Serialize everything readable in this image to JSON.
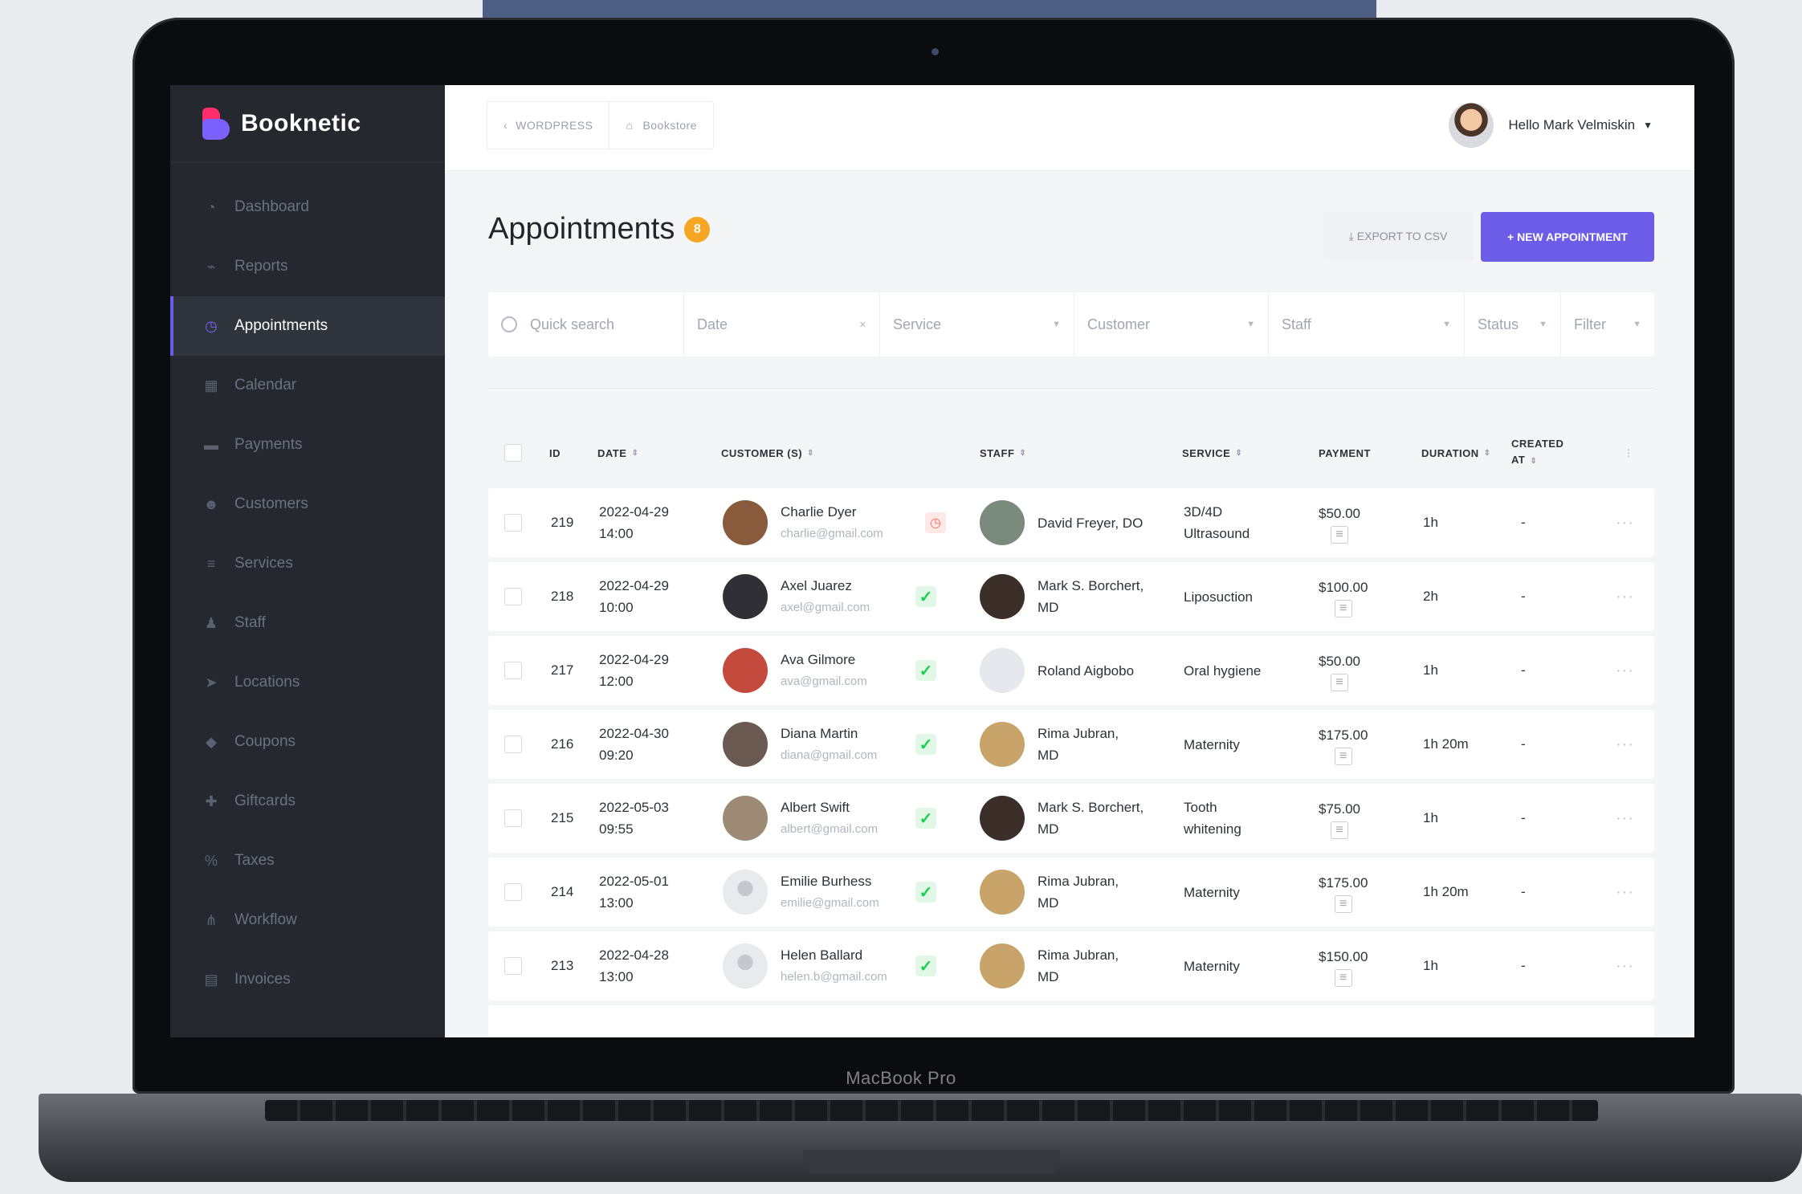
{
  "device": {
    "label": "MacBook Pro"
  },
  "brand": {
    "name": "Booknetic"
  },
  "sidebar": {
    "items": [
      {
        "label": "Dashboard",
        "icon": "dashboard-icon"
      },
      {
        "label": "Reports",
        "icon": "chart-icon"
      },
      {
        "label": "Appointments",
        "icon": "clock-icon",
        "active": true
      },
      {
        "label": "Calendar",
        "icon": "calendar-icon"
      },
      {
        "label": "Payments",
        "icon": "card-icon"
      },
      {
        "label": "Customers",
        "icon": "users-icon"
      },
      {
        "label": "Services",
        "icon": "list-icon"
      },
      {
        "label": "Staff",
        "icon": "person-icon"
      },
      {
        "label": "Locations",
        "icon": "location-icon"
      },
      {
        "label": "Coupons",
        "icon": "tag-icon"
      },
      {
        "label": "Giftcards",
        "icon": "gift-icon"
      },
      {
        "label": "Taxes",
        "icon": "percent-icon"
      },
      {
        "label": "Workflow",
        "icon": "workflow-icon"
      },
      {
        "label": "Invoices",
        "icon": "file-icon"
      }
    ]
  },
  "header": {
    "breadcrumb_back": "WORDPRESS",
    "breadcrumb_current": "Bookstore",
    "user_greeting": "Hello Mark Velmiskin"
  },
  "page": {
    "title": "Appointments",
    "count": "8",
    "export_label": "EXPORT TO CSV",
    "new_label": "+ NEW APPOINTMENT"
  },
  "filters": {
    "search_placeholder": "Quick search",
    "date": "Date",
    "service": "Service",
    "customer": "Customer",
    "staff": "Staff",
    "status": "Status",
    "filter": "Filter"
  },
  "table": {
    "columns": {
      "id": "ID",
      "date": "DATE",
      "customers": "CUSTOMER (S)",
      "staff": "STAFF",
      "service": "SERVICE",
      "payment": "PAYMENT",
      "duration": "DURATION",
      "created_line1": "CREATED",
      "created_line2": "AT"
    },
    "rows": [
      {
        "id": "219",
        "date": "2022-04-29",
        "time": "14:00",
        "customer": "Charlie Dyer",
        "email": "charlie@gmail.com",
        "status": "pending",
        "staff_l1": "David Freyer, DO",
        "staff_l2": "",
        "service_l1": "3D/4D",
        "service_l2": "Ultrasound",
        "payment": "$50.00",
        "duration": "1h",
        "created": "-"
      },
      {
        "id": "218",
        "date": "2022-04-29",
        "time": "10:00",
        "customer": "Axel Juarez",
        "email": "axel@gmail.com",
        "status": "approved",
        "staff_l1": "Mark S. Borchert,",
        "staff_l2": "MD",
        "service_l1": "Liposuction",
        "service_l2": "",
        "payment": "$100.00",
        "duration": "2h",
        "created": "-"
      },
      {
        "id": "217",
        "date": "2022-04-29",
        "time": "12:00",
        "customer": "Ava Gilmore",
        "email": "ava@gmail.com",
        "status": "approved",
        "staff_l1": "Roland Aigbobo",
        "staff_l2": "",
        "service_l1": "Oral hygiene",
        "service_l2": "",
        "payment": "$50.00",
        "duration": "1h",
        "created": "-"
      },
      {
        "id": "216",
        "date": "2022-04-30",
        "time": "09:20",
        "customer": "Diana Martin",
        "email": "diana@gmail.com",
        "status": "approved",
        "staff_l1": "Rima Jubran,",
        "staff_l2": "MD",
        "service_l1": "Maternity",
        "service_l2": "",
        "payment": "$175.00",
        "duration": "1h 20m",
        "created": "-"
      },
      {
        "id": "215",
        "date": "2022-05-03",
        "time": "09:55",
        "customer": "Albert Swift",
        "email": "albert@gmail.com",
        "status": "approved",
        "staff_l1": "Mark S. Borchert,",
        "staff_l2": "MD",
        "service_l1": "Tooth",
        "service_l2": "whitening",
        "payment": "$75.00",
        "duration": "1h",
        "created": "-"
      },
      {
        "id": "214",
        "date": "2022-05-01",
        "time": "13:00",
        "customer": "Emilie Burhess",
        "email": "emilie@gmail.com",
        "status": "approved",
        "staff_l1": "Rima Jubran,",
        "staff_l2": "MD",
        "service_l1": "Maternity",
        "service_l2": "",
        "payment": "$175.00",
        "duration": "1h 20m",
        "created": "-"
      },
      {
        "id": "213",
        "date": "2022-04-28",
        "time": "13:00",
        "customer": "Helen Ballard",
        "email": "helen.b@gmail.com",
        "status": "approved",
        "staff_l1": "Rima Jubran,",
        "staff_l2": "MD",
        "service_l1": "Maternity",
        "service_l2": "",
        "payment": "$150.00",
        "duration": "1h",
        "created": "-"
      }
    ]
  },
  "colors": {
    "accent": "#6c5ce7",
    "sidebar": "#25282f",
    "badge": "#f5a623",
    "success": "#1fcf52",
    "pending": "#ff6b5b"
  }
}
